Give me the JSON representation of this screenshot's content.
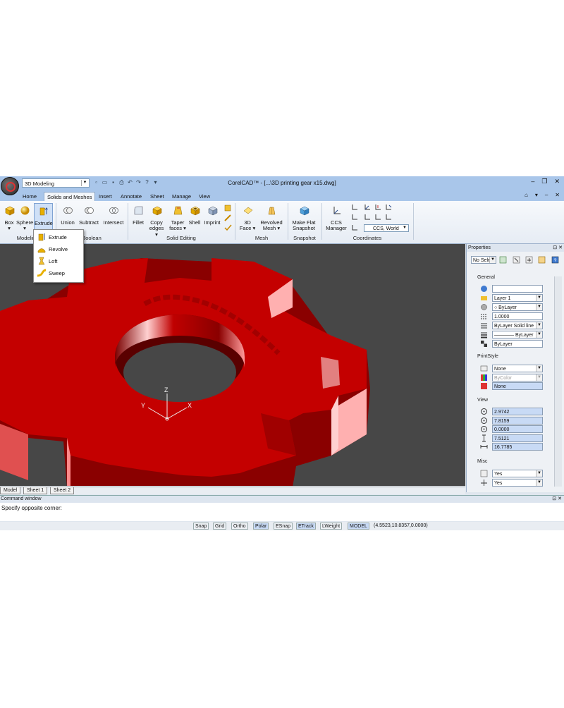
{
  "app": {
    "workspace": "3D Modeling",
    "window_title": "CorelCAD™ - [...\\3D printing gear x15.dwg]",
    "window_buttons": [
      "–",
      "❐",
      "✕"
    ]
  },
  "tabs": [
    "Home",
    "Solids and Meshes",
    "Insert",
    "Annotate",
    "Sheet",
    "Manage",
    "View"
  ],
  "ribbon": {
    "modeling": {
      "box": "Box",
      "sphere": "Sphere",
      "extrude": "Extrude",
      "group": "Modeling"
    },
    "boolean": {
      "union": "Union",
      "subtract": "Subtract",
      "intersect": "Intersect",
      "group": "Boolean"
    },
    "solid_editing": {
      "fillet": "Fillet",
      "copy_edges_1": "Copy",
      "copy_edges_2": "edges ▾",
      "taper_1": "Taper",
      "taper_2": "faces ▾",
      "shell": "Shell",
      "imprint": "Imprint",
      "group": "Solid Editing"
    },
    "mesh": {
      "face_1": "3D",
      "face_2": "Face ▾",
      "revolved_1": "Revolved",
      "revolved_2": "Mesh ▾",
      "group": "Mesh"
    },
    "snapshot": {
      "make_flat_1": "Make Flat",
      "make_flat_2": "Snapshot",
      "group": "Snapshot"
    },
    "coordinates": {
      "ccs_1": "CCS",
      "ccs_2": "Manager",
      "ccs_select": "CCS, World",
      "group": "Coordinates"
    }
  },
  "extrude_menu": [
    "Extrude",
    "Revolve",
    "Loft",
    "Sweep"
  ],
  "sheets": [
    "Model",
    "Sheet 1",
    "Sheet 2"
  ],
  "properties": {
    "title": "Properties",
    "selection": "No Sele",
    "general_label": "General",
    "general": [
      "",
      "Layer 1",
      "○ ByLayer",
      "1.0000",
      "ByLayer     Solid line",
      "———— ByLayer",
      "ByLayer"
    ],
    "printstyle_label": "PrintStyle",
    "printstyle": [
      "None",
      "ByColor",
      "None"
    ],
    "view_label": "View",
    "view": [
      "2.9742",
      "7.8159",
      "0.0000",
      "7.5121",
      "16.7785"
    ],
    "misc_label": "Misc",
    "misc": [
      "Yes",
      "Yes"
    ]
  },
  "command": {
    "title": "Command window",
    "line": "Specify opposite corner:"
  },
  "status": {
    "buttons": [
      "Snap",
      "Grid",
      "Ortho",
      "Polar",
      "ESnap",
      "ETrack",
      "LWeight",
      "MODEL"
    ],
    "coords": "(4.5523,10.8357,0.0000)"
  },
  "colors": {
    "ribbon_blue": "#a9c6ea",
    "gear_red": "#c40000",
    "viewport": "#474747"
  }
}
